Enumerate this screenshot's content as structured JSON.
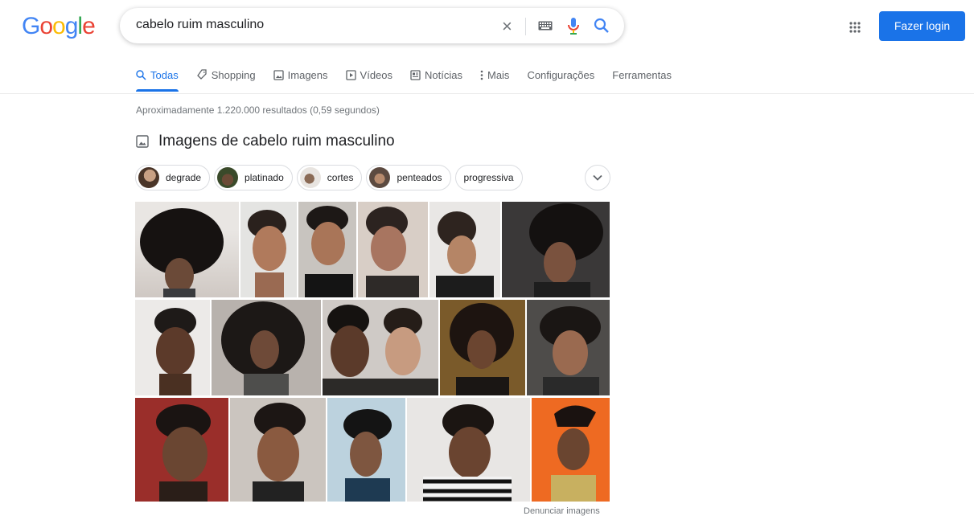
{
  "logo": {
    "letters": [
      "G",
      "o",
      "o",
      "g",
      "l",
      "e"
    ],
    "colors": [
      "#4285f4",
      "#ea4335",
      "#fbbc05",
      "#4285f4",
      "#34a853",
      "#ea4335"
    ]
  },
  "search": {
    "query": "cabelo ruim masculino",
    "clear_icon": "×"
  },
  "header": {
    "login_label": "Fazer login"
  },
  "tabs": [
    {
      "label": "Todas",
      "icon": "search-icon",
      "active": true
    },
    {
      "label": "Shopping",
      "icon": "tag-icon"
    },
    {
      "label": "Imagens",
      "icon": "image-icon"
    },
    {
      "label": "Vídeos",
      "icon": "play-icon"
    },
    {
      "label": "Notícias",
      "icon": "news-icon"
    },
    {
      "label": "Mais",
      "icon": "more-vert-icon"
    },
    {
      "label": "Configurações"
    },
    {
      "label": "Ferramentas"
    }
  ],
  "results": {
    "stats": "Aproximadamente 1.220.000 resultados (0,59 segundos)"
  },
  "images": {
    "heading": "Imagens de cabelo ruim masculino",
    "chips": [
      {
        "label": "degrade"
      },
      {
        "label": "platinado"
      },
      {
        "label": "cortes"
      },
      {
        "label": "penteados"
      },
      {
        "label": "progressiva"
      }
    ],
    "report": "Denunciar imagens"
  },
  "colors": {
    "accent": "#1a73e8",
    "text_muted": "#70757a",
    "border": "#dadce0"
  }
}
